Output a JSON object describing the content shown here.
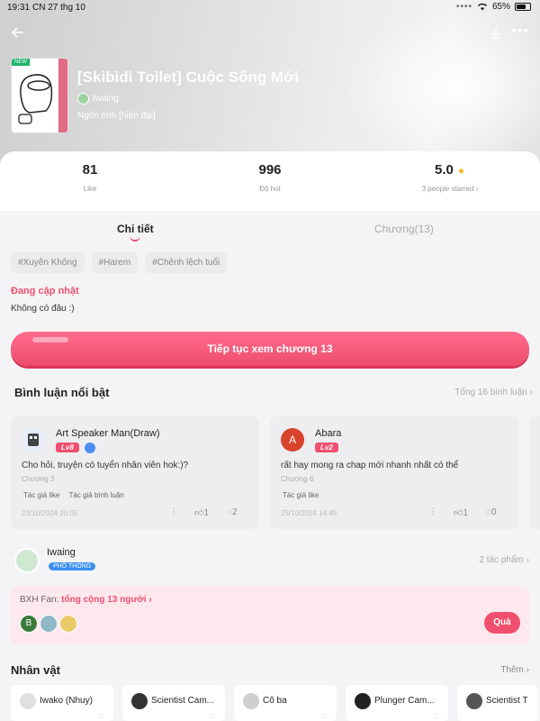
{
  "status_bar": {
    "time": "19:31",
    "date": "CN 27 thg 10",
    "battery": "65%"
  },
  "header": {
    "title": "[Skibidi Toilet] Cuộc Sống Mới",
    "author": "Iwaing",
    "genre": "Ngôn tình [hiện đại]",
    "cover_badge": "NEW",
    "icons": {
      "back": "back-arrow-icon",
      "download": "download-icon",
      "more": "more-icon"
    }
  },
  "stats": [
    {
      "value": "81",
      "label": "Like"
    },
    {
      "value": "996",
      "label": "Độ hot"
    },
    {
      "value": "5.0",
      "label": "3 people starred"
    }
  ],
  "tabs": [
    {
      "label": "Chi tiết",
      "active": true
    },
    {
      "label": "Chương(13)",
      "active": false
    }
  ],
  "tags": [
    "#Xuyên Không",
    "#Harem",
    "#Chênh lệch tuổi"
  ],
  "status_title": "Đang cập nhật",
  "description": "Không có đâu :)",
  "continue_button": "Tiếp tục xem chương 13",
  "comments_section": {
    "title": "Bình luận nổi bật",
    "total": "Tổng 16 bình luận"
  },
  "comments": [
    {
      "name": "Art Speaker Man(Draw)",
      "level": "Lv8",
      "text": "Cho hỏi, truyện có tuyển nhân viên hok:)?",
      "chapter": "Chương 3",
      "badges": [
        "Tác giả like",
        "Tác giả bình luận"
      ],
      "date": "23/10/2024 20:05",
      "likes": "1",
      "replies": "2",
      "avatar_letter": "",
      "avatar_color": "#4a8ff0"
    },
    {
      "name": "Abara",
      "level": "Lv2",
      "text": "rất hay mong ra chap mới nhanh nhất có thể",
      "chapter": "Chương 6",
      "badges": [
        "Tác giả like"
      ],
      "date": "25/10/2024 14:45",
      "likes": "1",
      "replies": "0",
      "avatar_letter": "A",
      "avatar_color": "#d8432b"
    }
  ],
  "author_section": {
    "name": "Iwaing",
    "rank": "PHỔ THÔNG",
    "works": "2 tác phẩm"
  },
  "fan_rank": {
    "label": "BXH Fan:",
    "total": "tổng cộng 13 người",
    "gift_button": "Quà",
    "fans": [
      "B",
      "",
      ""
    ]
  },
  "characters_section": {
    "title": "Nhân vật",
    "more": "Thêm"
  },
  "characters": [
    {
      "name": "Iwako (Nhuy)",
      "color": "#e0e0e0"
    },
    {
      "name": "Scientist Cam...",
      "color": "#333333"
    },
    {
      "name": "Cô ba",
      "color": "#cfcfcf"
    },
    {
      "name": "Plunger Cam...",
      "color": "#222222"
    },
    {
      "name": "Scientist T",
      "color": "#555555"
    }
  ]
}
